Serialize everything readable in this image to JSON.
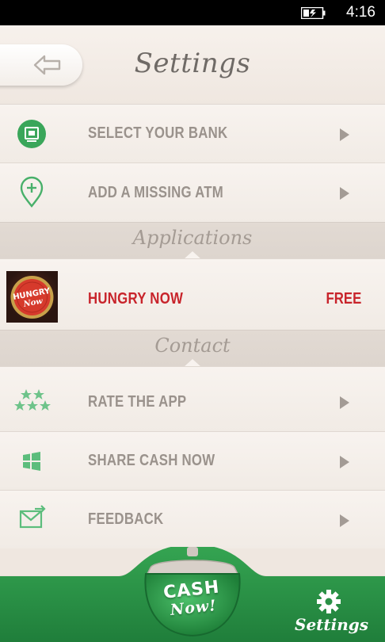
{
  "status_bar": {
    "time": "4:16",
    "battery_icon": "battery-charging-icon"
  },
  "header": {
    "title": "Settings",
    "back_icon": "back-arrow-icon"
  },
  "rows_top": [
    {
      "label": "SELECT YOUR BANK",
      "icon": "atm-card-icon"
    },
    {
      "label": "ADD A MISSING ATM",
      "icon": "map-pin-plus-icon"
    }
  ],
  "sections": {
    "applications": "Applications",
    "contact": "Contact"
  },
  "app_promo": {
    "label": "HUNGRY NOW",
    "price": "FREE",
    "thumb_text": "Hungry Now"
  },
  "rows_contact": [
    {
      "label": "RATE THE APP",
      "icon": "stars-icon"
    },
    {
      "label": "SHARE CASH NOW",
      "icon": "windows-logo-icon"
    },
    {
      "label": "FEEDBACK",
      "icon": "envelope-arrow-icon"
    }
  ],
  "bottom_bar": {
    "cash_main": "CASH",
    "cash_sub": "Now!",
    "settings_label": "Settings",
    "settings_icon": "gear-icon"
  },
  "colors": {
    "accent_green": "#2f9a4c",
    "label_gray": "#9a928c",
    "promo_red": "#c8242b"
  }
}
